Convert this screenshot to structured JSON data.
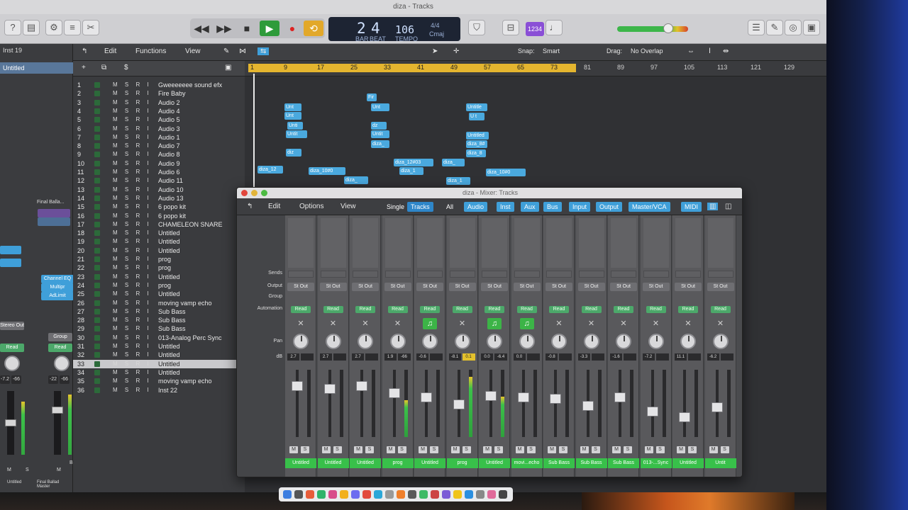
{
  "window": {
    "title": "diza - Tracks"
  },
  "lcd": {
    "bar": "2",
    "beat": "4",
    "bar_label": "BAR",
    "beat_label": "BEAT",
    "tempo": "106",
    "tempo_label": "TEMPO",
    "sig": "4/4",
    "key": "Cmaj"
  },
  "controlbar": {
    "count_in": "1234"
  },
  "inspector": {
    "region": "Inst 19",
    "track": "Untitled",
    "strip_a_name": "Final Balla...",
    "strip_b_name": "Final Ballad Master",
    "eq_label": "Channel EQ",
    "multipr": "Multipr",
    "adlimit": "AdLimit",
    "stereo_out": "Stereo Out",
    "group": "Group",
    "read": "Read",
    "db_a": "-7.2",
    "pk_a": "-66",
    "db_b": "-22",
    "pk_b": "-66",
    "bnce": "Bnce",
    "slot_a": "Untitled",
    "slot_b": "Final Ballad Master",
    "m": "M",
    "s": "S"
  },
  "tracks_menu": {
    "edit": "Edit",
    "functions": "Functions",
    "view": "View",
    "snap_label": "Snap:",
    "snap_value": "Smart",
    "drag_label": "Drag:",
    "drag_value": "No Overlap"
  },
  "ruler": [
    "1",
    "9",
    "17",
    "25",
    "33",
    "41",
    "49",
    "57",
    "65",
    "73",
    "81",
    "89",
    "97",
    "105",
    "113",
    "121",
    "129"
  ],
  "tracks": [
    {
      "n": "1",
      "name": "Gweeeeeee sound efx"
    },
    {
      "n": "2",
      "name": "Fire Baby"
    },
    {
      "n": "3",
      "name": "Audio 2"
    },
    {
      "n": "4",
      "name": "Audio 4"
    },
    {
      "n": "5",
      "name": "Audio 5"
    },
    {
      "n": "6",
      "name": "Audio 3"
    },
    {
      "n": "7",
      "name": "Audio 1"
    },
    {
      "n": "8",
      "name": "Audio 7"
    },
    {
      "n": "9",
      "name": "Audio 8"
    },
    {
      "n": "10",
      "name": "Audio 9"
    },
    {
      "n": "11",
      "name": "Audio 6"
    },
    {
      "n": "12",
      "name": "Audio 11"
    },
    {
      "n": "13",
      "name": "Audio 10"
    },
    {
      "n": "14",
      "name": "Audio 13"
    },
    {
      "n": "15",
      "name": "6 popo kit"
    },
    {
      "n": "16",
      "name": "6 popo kit"
    },
    {
      "n": "17",
      "name": "CHAMELEON SNARE"
    },
    {
      "n": "18",
      "name": "Untitled"
    },
    {
      "n": "19",
      "name": "Untitled"
    },
    {
      "n": "20",
      "name": "Untitled"
    },
    {
      "n": "21",
      "name": "prog"
    },
    {
      "n": "22",
      "name": "prog"
    },
    {
      "n": "23",
      "name": "Untitled"
    },
    {
      "n": "24",
      "name": "prog"
    },
    {
      "n": "25",
      "name": "Untitled"
    },
    {
      "n": "26",
      "name": "moving vamp echo"
    },
    {
      "n": "27",
      "name": "Sub Bass"
    },
    {
      "n": "28",
      "name": "Sub Bass"
    },
    {
      "n": "29",
      "name": "Sub Bass"
    },
    {
      "n": "30",
      "name": "013-Analog Perc Sync"
    },
    {
      "n": "31",
      "name": "Untitled"
    },
    {
      "n": "32",
      "name": "Untitled"
    },
    {
      "n": "33",
      "name": "Untitled"
    },
    {
      "n": "34",
      "name": "Untitled"
    },
    {
      "n": "35",
      "name": "moving vamp echo"
    },
    {
      "n": "36",
      "name": "Inst 22"
    }
  ],
  "track_ms": "M S R I",
  "regions": [
    "Unt",
    "Unt",
    "Untit",
    "diz",
    "Fir",
    "Unt",
    "Untit",
    "diza_",
    "diza_12",
    "diza_10#0",
    "diza_",
    "diza_12#03",
    "diza_1",
    "diza_",
    "Untitle",
    "Untitled",
    "diza_8#",
    "diza_8",
    "diza_1",
    "diza_10#0",
    "Unti",
    "dz",
    "U t"
  ],
  "mixer": {
    "title": "diza - Mixer: Tracks",
    "menu": {
      "edit": "Edit",
      "options": "Options",
      "view": "View"
    },
    "filters": [
      "Single",
      "Tracks",
      "All",
      "Audio",
      "Inst",
      "Aux",
      "Bus",
      "Input",
      "Output",
      "Master/VCA",
      "MIDI"
    ],
    "row_labels": {
      "sends": "Sends",
      "output": "Output",
      "group": "Group",
      "automation": "Automation",
      "pan": "Pan",
      "db": "dB"
    },
    "strips": [
      {
        "out": "St Out",
        "auto": "Read",
        "inst": "",
        "db": "2.7",
        "pk": "",
        "name": "Untitled",
        "lvl": 0
      },
      {
        "out": "St Out",
        "auto": "Read",
        "inst": "",
        "db": "2.7",
        "pk": "",
        "name": "Untitled",
        "lvl": 0
      },
      {
        "out": "St Out",
        "auto": "Read",
        "inst": "",
        "db": "2.7",
        "pk": "",
        "name": "Untitled",
        "lvl": 0
      },
      {
        "out": "St Out",
        "auto": "Read",
        "inst": "",
        "db": "1.9",
        "pk": "-66",
        "name": "prog",
        "lvl": 55
      },
      {
        "out": "St Out",
        "auto": "Read",
        "inst": "♫",
        "db": "-0.6",
        "pk": "",
        "name": "Untitled",
        "lvl": 0
      },
      {
        "out": "St Out",
        "auto": "Read",
        "inst": "",
        "db": "-8.1",
        "pk": "0.1",
        "name": "prog",
        "lvl": 90
      },
      {
        "out": "St Out",
        "auto": "Read",
        "inst": "♫",
        "db": "0.0",
        "pk": "-6.4",
        "name": "Untitled",
        "lvl": 60
      },
      {
        "out": "St Out",
        "auto": "Read",
        "inst": "♫",
        "db": "0.0",
        "pk": "",
        "name": "movi...echo",
        "lvl": 0
      },
      {
        "out": "St Out",
        "auto": "Read",
        "inst": "",
        "db": "-0.8",
        "pk": "",
        "name": "Sub Bass",
        "lvl": 0
      },
      {
        "out": "St Out",
        "auto": "Read",
        "inst": "",
        "db": "-3.3",
        "pk": "",
        "name": "Sub Bass",
        "lvl": 0
      },
      {
        "out": "St Out",
        "auto": "Read",
        "inst": "",
        "db": "-1.6",
        "pk": "",
        "name": "Sub Bass",
        "lvl": 0
      },
      {
        "out": "St Out",
        "auto": "Read",
        "inst": "",
        "db": "-7.2",
        "pk": "",
        "name": "013-...Sync",
        "lvl": 0
      },
      {
        "out": "St Out",
        "auto": "Read",
        "inst": "",
        "db": "11.1",
        "pk": "",
        "name": "Untitled",
        "lvl": 0
      },
      {
        "out": "St Out",
        "auto": "Read",
        "inst": "",
        "db": "-6.2",
        "pk": "",
        "name": "Untit",
        "lvl": 0
      }
    ],
    "m": "M",
    "s": "S"
  },
  "colors": {
    "region": "#4aa9de",
    "cycle": "#e4b52f",
    "strip_name": "#38c04a",
    "read": "#4ca86a",
    "filter_on": "#3f9fd9"
  }
}
